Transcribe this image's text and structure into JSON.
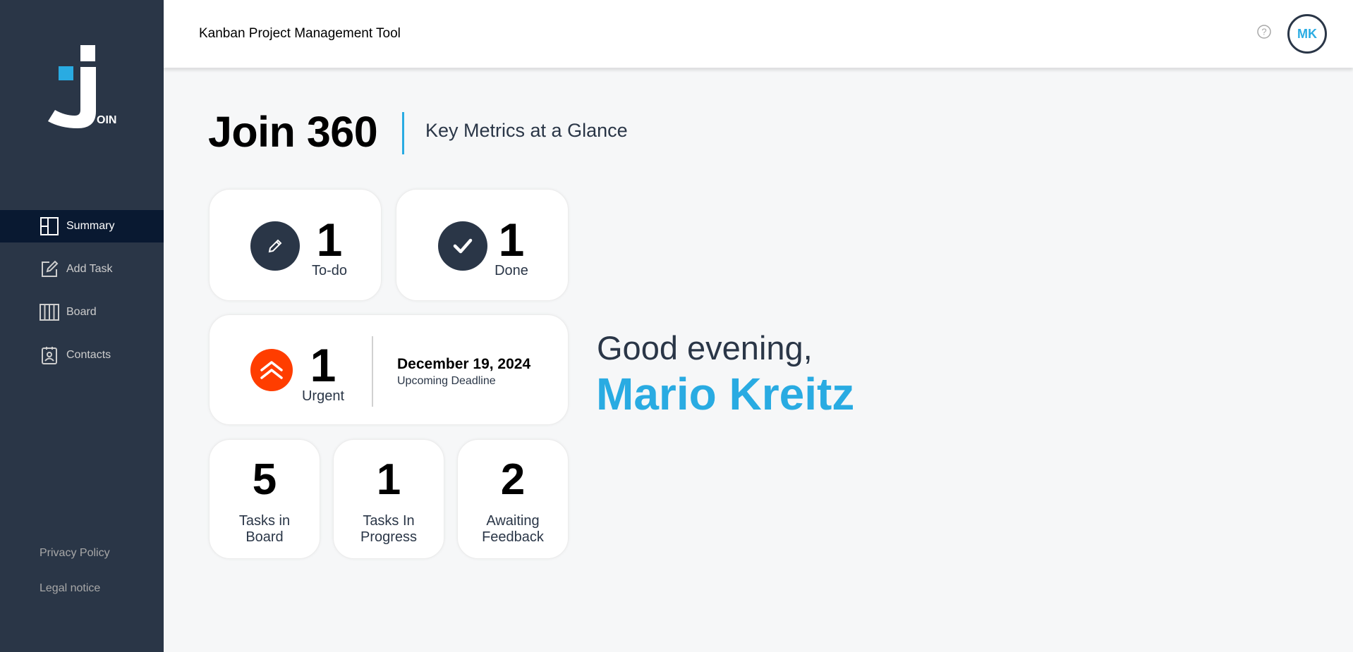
{
  "app": {
    "header_title": "Kanban Project Management Tool",
    "user_initials": "MK",
    "logo_text": "OIN"
  },
  "sidebar": {
    "items": [
      {
        "label": "Summary",
        "icon": "summary-icon",
        "active": true
      },
      {
        "label": "Add Task",
        "icon": "add-task-icon",
        "active": false
      },
      {
        "label": "Board",
        "icon": "board-icon",
        "active": false
      },
      {
        "label": "Contacts",
        "icon": "contacts-icon",
        "active": false
      }
    ],
    "footer": {
      "privacy": "Privacy Policy",
      "legal": "Legal notice"
    }
  },
  "summary": {
    "title": "Join 360",
    "subtitle": "Key Metrics at a Glance",
    "todo": {
      "count": "1",
      "label": "To-do"
    },
    "done": {
      "count": "1",
      "label": "Done"
    },
    "urgent": {
      "count": "1",
      "label": "Urgent",
      "deadline_date": "December 19, 2024",
      "deadline_label": "Upcoming Deadline"
    },
    "board": {
      "count": "5",
      "label_line1": "Tasks in",
      "label_line2": "Board"
    },
    "in_progress": {
      "count": "1",
      "label_line1": "Tasks In",
      "label_line2": "Progress"
    },
    "feedback": {
      "count": "2",
      "label_line1": "Awaiting",
      "label_line2": "Feedback"
    }
  },
  "greeting": {
    "text": "Good evening,",
    "name": "Mario Kreitz"
  },
  "colors": {
    "sidebar": "#2a3647",
    "accent": "#29abe2",
    "urgent": "#ff3d00",
    "active_nav": "#091931"
  }
}
